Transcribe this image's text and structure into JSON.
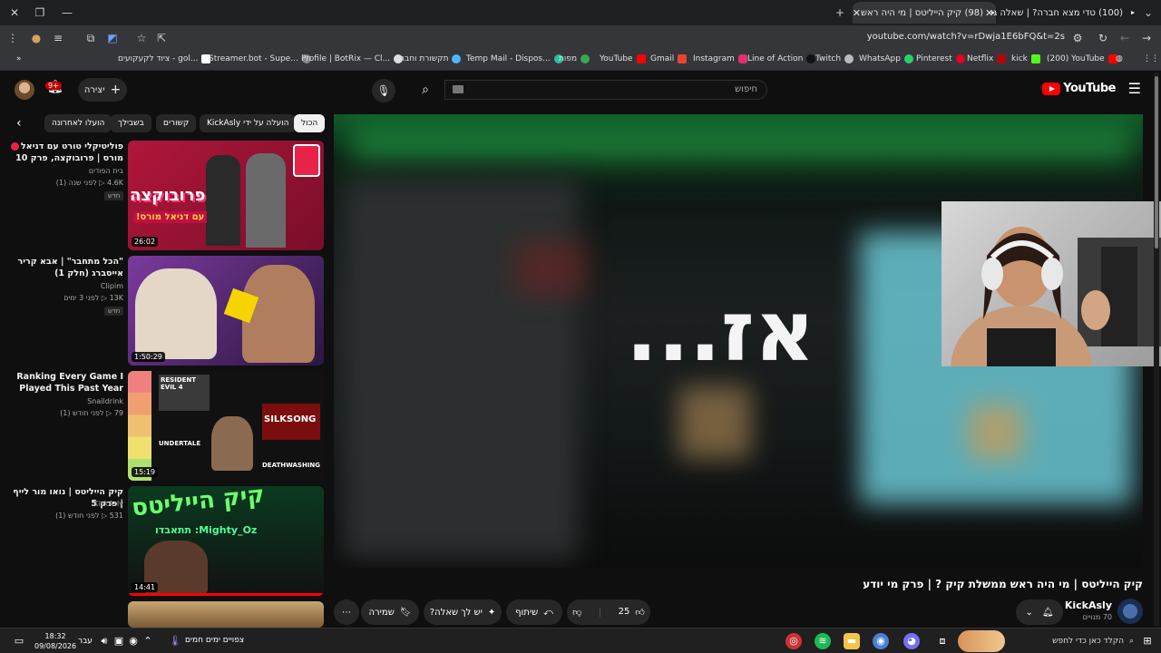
{
  "browser": {
    "tabs": [
      {
        "label": "(100) טדי מצא חברה? | שאלה ג"
      },
      {
        "label": "(98) קיק הייליטס | מי היה ראש"
      }
    ],
    "url": "youtube.com/watch?v=rDwja1E6bFQ&t=2s",
    "bookmarks": [
      {
        "label": "(200) YouTube"
      },
      {
        "label": "kick"
      },
      {
        "label": "Netflix"
      },
      {
        "label": "Pinterest"
      },
      {
        "label": "WhatsApp"
      },
      {
        "label": "Twitch"
      },
      {
        "label": "Line of Action"
      },
      {
        "label": "Instagram"
      },
      {
        "label": "Gmail"
      },
      {
        "label": "YouTube"
      },
      {
        "label": "מפות"
      },
      {
        "label": "Temp Mail - Dispos..."
      },
      {
        "label": "תקשורת וחברה"
      },
      {
        "label": "Profile | BotRix — Cl..."
      },
      {
        "label": "Streamer.bot - Supe..."
      },
      {
        "label": "ציוד לקעקועים - gol..."
      }
    ]
  },
  "header": {
    "logo": "YouTube",
    "search_placeholder": "חיפוש",
    "create_label": "יצירה",
    "notif_count": "9+"
  },
  "chips": {
    "all": "הכול",
    "uploaded_by": "הועלה על ידי KickAsly",
    "related": "קשורים",
    "for_you": "בשבילך",
    "recent": "הועלו לאחרונה"
  },
  "video": {
    "overlay_text": "אז...",
    "title": "קיק הייליטס | מי היה ראש ממשלת קיק ? | פרק מי יודע",
    "channel": "KickAsly",
    "subscribers": "70 מנויים",
    "likes": "25",
    "share": "שיתוף",
    "ask": "יש לך שאלה?",
    "save": "שמירה"
  },
  "recommendations": [
    {
      "title": "פוליטיקלי טורט עם דניאל מורס | פרובוקצה, פרק 10",
      "channel": "בית הפודים",
      "meta": "4.6K ▷ לפני שנה (1)",
      "duration": "26:02",
      "badge": "חדש",
      "thumb_text": "פרובוקצה",
      "thumb_sub": "עם דניאל מורס!"
    },
    {
      "title": "\"הכל מתחבר\" | אבא קריר אייסברג (חלק 1)",
      "channel": "Clipim",
      "meta": "13K ▷ לפני 3 ימים",
      "duration": "1:50:29",
      "badge": "חדש"
    },
    {
      "title": "Ranking Every Game I Played This Past Year",
      "channel": "Snaildrink",
      "meta": "79 ▷ לפני חודש (1)",
      "duration": "15:19",
      "thumb_labels": [
        "RESIDENT EVIL 4",
        "SILKSONG",
        "UNDERTALE",
        "DEATHWASHING"
      ]
    },
    {
      "title": "קיק הייליטס | נואו מור לייף | פרק 5",
      "channel": "KickAsly",
      "meta": "531 ▷ לפני חודש (1)",
      "duration": "14:41",
      "thumb_text": "קיק הייליטס",
      "thumb_user": "Mighty_Oz: תתאבדו"
    }
  ],
  "taskbar": {
    "time": "18:32",
    "date": "09/08/2026",
    "lang": "עבר",
    "weather": "צפויים ימים חמים",
    "search": "הקלד כאן כדי לחפש"
  },
  "colors": {
    "bg": "#0f0f0f",
    "accent_red": "#ff0000",
    "chip_bg": "#272727"
  }
}
